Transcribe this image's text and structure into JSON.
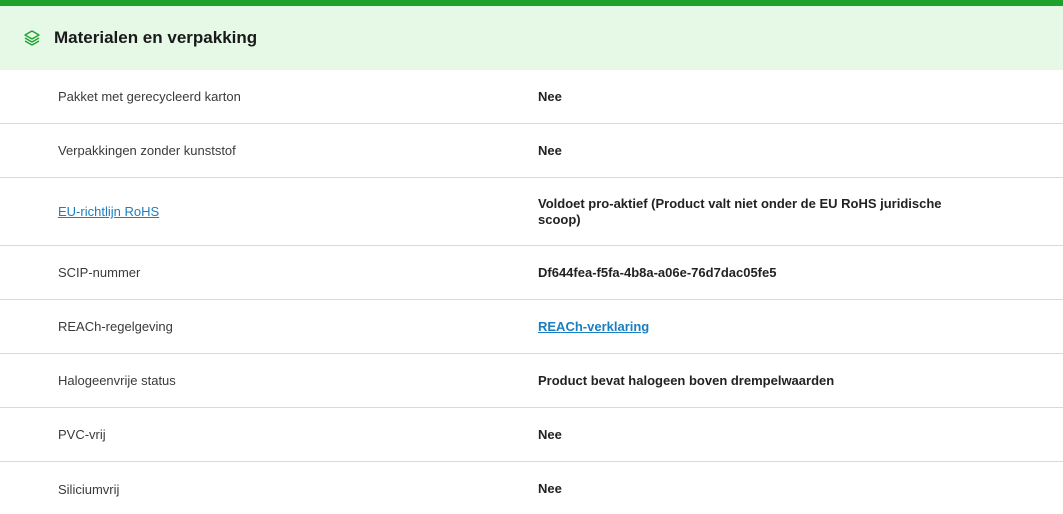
{
  "section": {
    "title": "Materialen en verpakking",
    "icon": "layers-icon",
    "accent_color": "#1fa12e",
    "header_bg": "#e6f8e6",
    "link_color": "#1a7fc1"
  },
  "rows": [
    {
      "label": "Pakket met gerecycleerd karton",
      "value": "Nee"
    },
    {
      "label": "Verpakkingen zonder kunststof",
      "value": "Nee"
    },
    {
      "label": "EU-richtlijn RoHS",
      "value": "Voldoet pro-aktief (Product valt niet onder de EU RoHS juridische scoop)"
    },
    {
      "label": "SCIP-nummer",
      "value": "Df644fea-f5fa-4b8a-a06e-76d7dac05fe5"
    },
    {
      "label": "REACh-regelgeving",
      "value": "REACh-verklaring"
    },
    {
      "label": "Halogeenvrije status",
      "value": "Product bevat halogeen boven drempelwaarden"
    },
    {
      "label": "PVC-vrij",
      "value": "Nee"
    },
    {
      "label": "Siliciumvrij",
      "value": "Nee"
    }
  ]
}
